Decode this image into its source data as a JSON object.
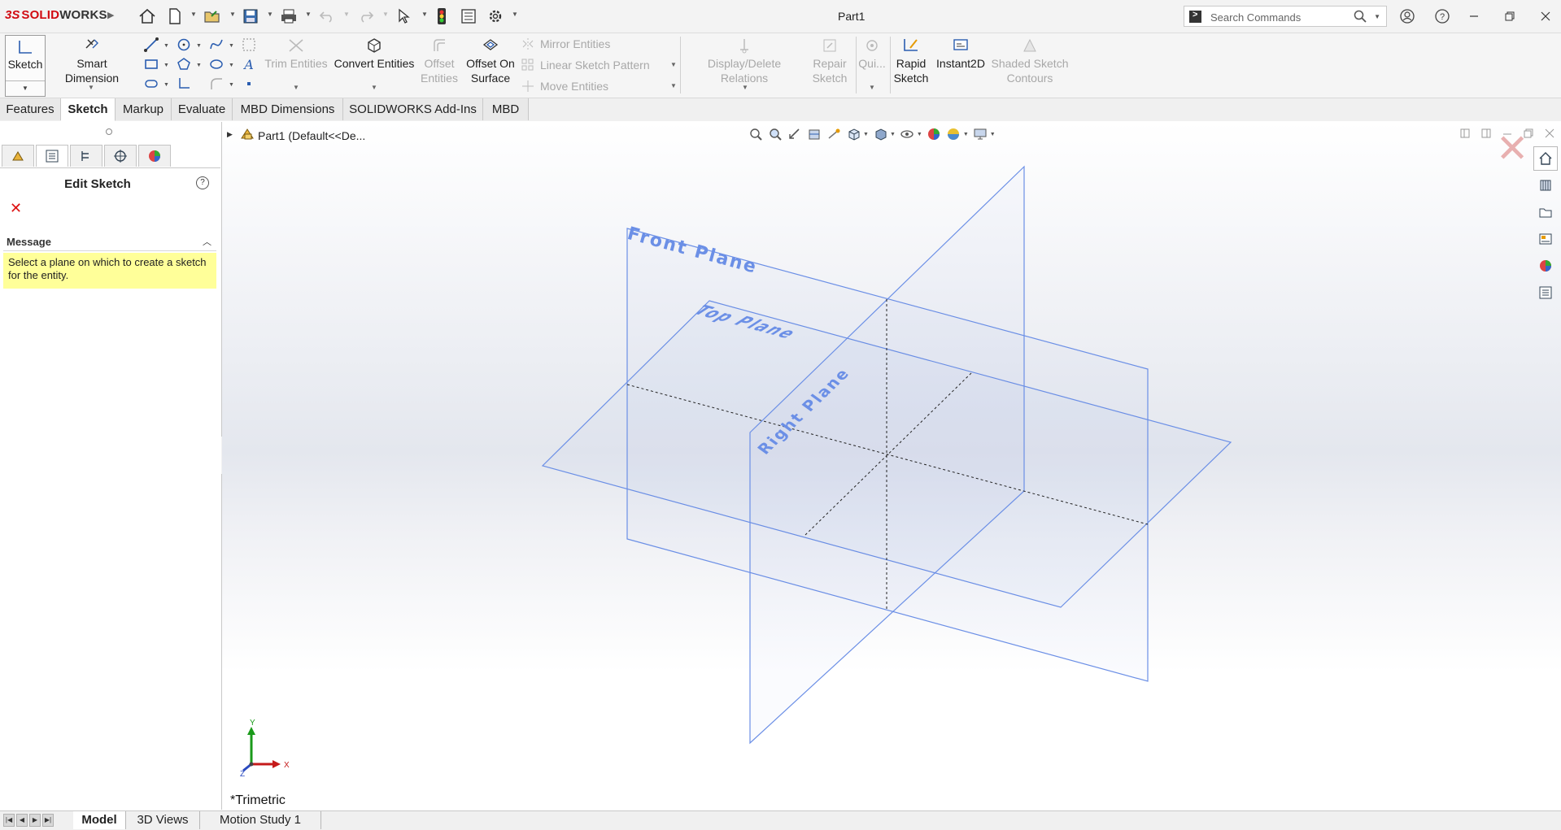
{
  "app": {
    "logo_prefix": "3S",
    "logo_solid": "SOLID",
    "logo_works": "WORKS",
    "document_title": "Part1"
  },
  "search": {
    "placeholder": "Search Commands"
  },
  "command_manager": {
    "sketch_label": "Sketch",
    "smart_dimension_label": "Smart Dimension",
    "trim_entities_label": "Trim Entities",
    "convert_entities_label": "Convert Entities",
    "offset_entities_label": "Offset Entities",
    "offset_on_surface_label": "Offset On Surface",
    "mirror_entities_label": "Mirror Entities",
    "linear_sketch_pattern_label": "Linear Sketch Pattern",
    "move_entities_label": "Move Entities",
    "display_delete_relations_label": "Display/Delete Relations",
    "repair_sketch_label": "Repair Sketch",
    "quick_snaps_label": "Qui...",
    "rapid_sketch_label": "Rapid Sketch",
    "instant2d_label": "Instant2D",
    "shaded_sketch_contours_label": "Shaded Sketch Contours"
  },
  "tabs": [
    {
      "label": "Features",
      "active": false
    },
    {
      "label": "Sketch",
      "active": true
    },
    {
      "label": "Markup",
      "active": false
    },
    {
      "label": "Evaluate",
      "active": false
    },
    {
      "label": "MBD Dimensions",
      "active": false
    },
    {
      "label": "SOLIDWORKS Add-Ins",
      "active": false
    },
    {
      "label": "MBD",
      "active": false
    }
  ],
  "property_manager": {
    "title": "Edit Sketch",
    "help_icon": "?",
    "cancel_icon": "✕",
    "message_heading": "Message",
    "message_text": "Select a plane on which to create a sketch for the entity."
  },
  "feature_tree": {
    "part_label": "Part1  (Default<<De..."
  },
  "planes": {
    "front": "Front Plane",
    "top": "Top Plane",
    "right": "Right Plane",
    "color": "#6b8fe6"
  },
  "triad": {
    "x": "X",
    "y": "Y",
    "z": "Z"
  },
  "view_orientation": "*Trimetric",
  "bottom_tabs": [
    {
      "label": "Model",
      "active": true
    },
    {
      "label": "3D Views",
      "active": false
    },
    {
      "label": "Motion Study 1",
      "active": false
    }
  ]
}
